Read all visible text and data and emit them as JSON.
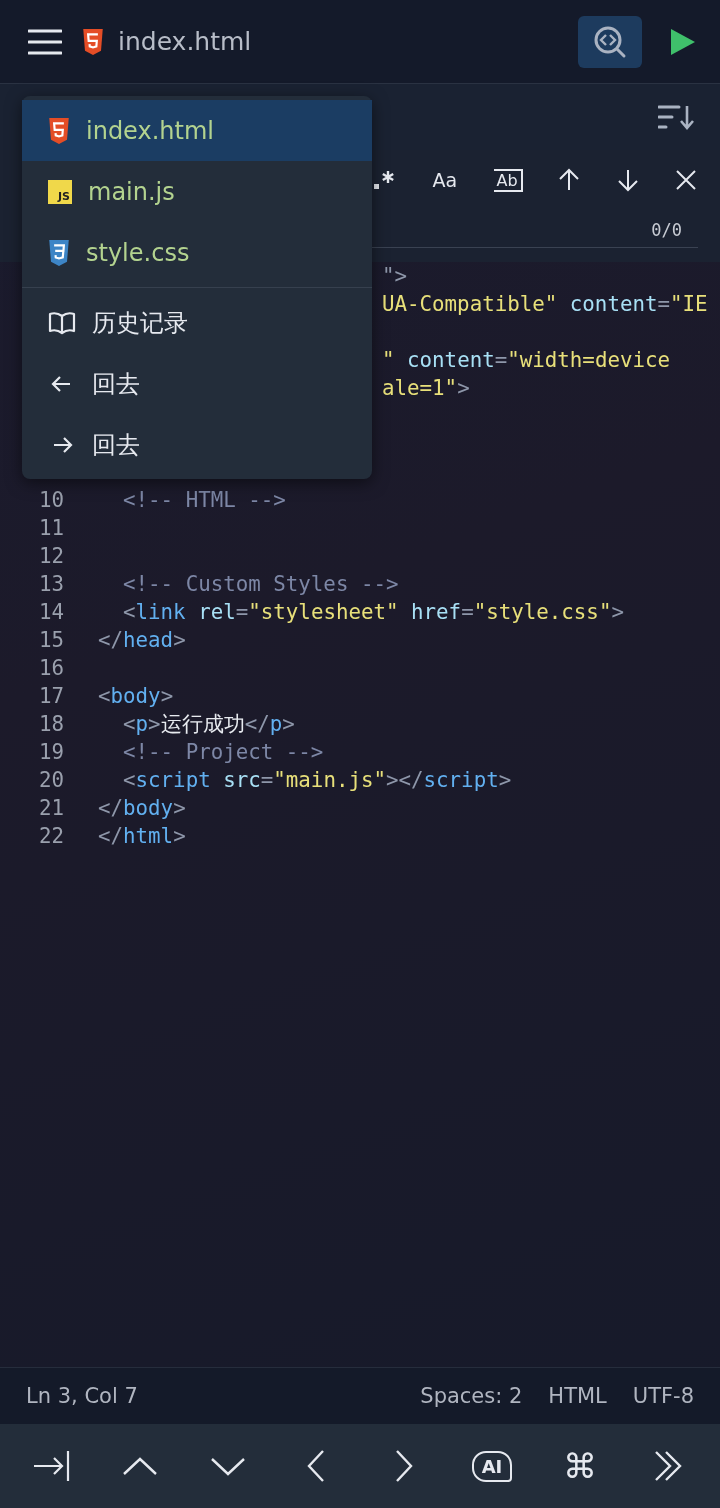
{
  "header": {
    "title": "index.html",
    "kind": "html"
  },
  "file_menu": {
    "files": [
      {
        "name": "index.html",
        "kind": "html",
        "selected": true
      },
      {
        "name": "main.js",
        "kind": "js",
        "icon_text": "JS",
        "selected": false
      },
      {
        "name": "style.css",
        "kind": "css",
        "selected": false
      }
    ],
    "actions": [
      {
        "label": "历史记录",
        "kind": "history"
      },
      {
        "label": "回去",
        "kind": "back"
      },
      {
        "label": "回去",
        "kind": "forward"
      }
    ]
  },
  "search_panel": {
    "options": [
      {
        "kind": "regex"
      },
      {
        "kind": "case",
        "label": "Aa"
      },
      {
        "kind": "word",
        "label": "Ab"
      },
      {
        "kind": "prev"
      },
      {
        "kind": "next"
      },
      {
        "kind": "close"
      }
    ],
    "match_count": "0/0"
  },
  "editor": {
    "lines": [
      {
        "kind": "clipped",
        "tokens": [
          {
            "kind": "punct",
            "text": "\">"
          }
        ]
      },
      {
        "kind": "clipped",
        "tokens": [
          {
            "kind": "string",
            "text": "UA-Compatible\""
          },
          {
            "kind": "attr",
            "text": " content"
          },
          {
            "kind": "punct",
            "text": "="
          },
          {
            "kind": "string",
            "text": "\"IE"
          }
        ]
      },
      {
        "kind": "blank"
      },
      {
        "kind": "clipped",
        "tokens": [
          {
            "kind": "string",
            "text": "\""
          },
          {
            "kind": "attr",
            "text": " content"
          },
          {
            "kind": "punct",
            "text": "="
          },
          {
            "kind": "string",
            "text": "\"width=device"
          }
        ]
      },
      {
        "kind": "clipped",
        "tokens": [
          {
            "kind": "string",
            "text": "ale=1\""
          },
          {
            "kind": "punct",
            "text": ">"
          }
        ]
      },
      {
        "kind": "blank"
      },
      {
        "kind": "blank"
      },
      {
        "kind": "blank"
      },
      {
        "number": "10",
        "tokens": [
          {
            "kind": "comment",
            "text": "  <!-- HTML -->"
          }
        ]
      },
      {
        "number": "11"
      },
      {
        "number": "12"
      },
      {
        "number": "13",
        "tokens": [
          {
            "kind": "comment",
            "text": "  <!-- Custom Styles -->"
          }
        ]
      },
      {
        "number": "14",
        "tokens": [
          {
            "kind": "punct",
            "text": "  <"
          },
          {
            "kind": "tag",
            "text": "link"
          },
          {
            "kind": "attr",
            "text": " rel"
          },
          {
            "kind": "punct",
            "text": "="
          },
          {
            "kind": "string",
            "text": "\"stylesheet\""
          },
          {
            "kind": "attr",
            "text": " href"
          },
          {
            "kind": "punct",
            "text": "="
          },
          {
            "kind": "string",
            "text": "\"style.css\""
          },
          {
            "kind": "punct",
            "text": ">"
          }
        ]
      },
      {
        "number": "15",
        "tokens": [
          {
            "kind": "punct",
            "text": "</"
          },
          {
            "kind": "tag",
            "text": "head"
          },
          {
            "kind": "punct",
            "text": ">"
          }
        ]
      },
      {
        "number": "16"
      },
      {
        "number": "17",
        "tokens": [
          {
            "kind": "punct",
            "text": "<"
          },
          {
            "kind": "tag",
            "text": "body"
          },
          {
            "kind": "punct",
            "text": ">"
          }
        ]
      },
      {
        "number": "18",
        "tokens": [
          {
            "kind": "punct",
            "text": "  <"
          },
          {
            "kind": "tag",
            "text": "p"
          },
          {
            "kind": "punct",
            "text": ">"
          },
          {
            "kind": "text",
            "text": "运行成功"
          },
          {
            "kind": "punct",
            "text": "</"
          },
          {
            "kind": "tag",
            "text": "p"
          },
          {
            "kind": "punct",
            "text": ">"
          }
        ]
      },
      {
        "number": "19",
        "tokens": [
          {
            "kind": "comment",
            "text": "  <!-- Project -->"
          }
        ]
      },
      {
        "number": "20",
        "tokens": [
          {
            "kind": "punct",
            "text": "  <"
          },
          {
            "kind": "tag",
            "text": "script"
          },
          {
            "kind": "attr",
            "text": " src"
          },
          {
            "kind": "punct",
            "text": "="
          },
          {
            "kind": "string",
            "text": "\"main.js\""
          },
          {
            "kind": "punct",
            "text": "></"
          },
          {
            "kind": "tag",
            "text": "script"
          },
          {
            "kind": "punct",
            "text": ">"
          }
        ]
      },
      {
        "number": "21",
        "tokens": [
          {
            "kind": "punct",
            "text": "</"
          },
          {
            "kind": "tag",
            "text": "body"
          },
          {
            "kind": "punct",
            "text": ">"
          }
        ]
      },
      {
        "number": "22",
        "tokens": [
          {
            "kind": "punct",
            "text": "</"
          },
          {
            "kind": "tag",
            "text": "html"
          },
          {
            "kind": "punct",
            "text": ">"
          }
        ]
      }
    ]
  },
  "status_bar": {
    "position": "Ln 3, Col 7",
    "items": [
      "Spaces: 2",
      "HTML",
      "UTF-8"
    ]
  },
  "toolbar": {
    "buttons": [
      {
        "kind": "tab"
      },
      {
        "kind": "up"
      },
      {
        "kind": "down"
      },
      {
        "kind": "left"
      },
      {
        "kind": "right"
      },
      {
        "kind": "ai",
        "label": "AI"
      },
      {
        "kind": "command",
        "label": "⌘"
      },
      {
        "kind": "more"
      }
    ]
  }
}
